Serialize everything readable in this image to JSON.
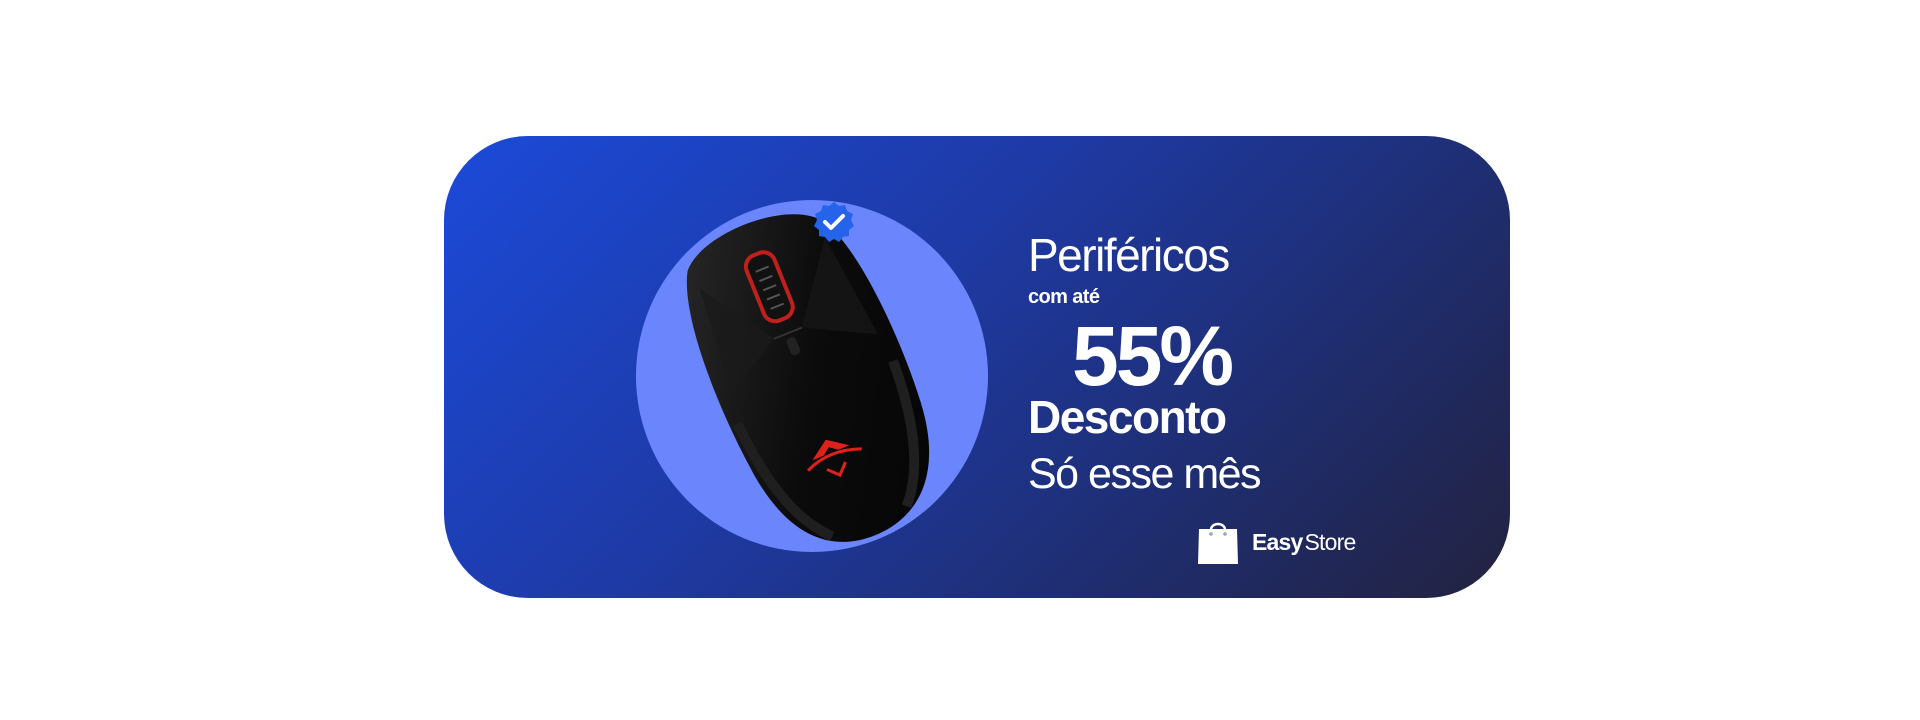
{
  "promo": {
    "headline": "Periféricos",
    "prefix": "com até",
    "discount": "55%",
    "discount_label": "Desconto",
    "tagline": "Só esse mês"
  },
  "brand": {
    "name_bold": "Easy",
    "name_light": "Store",
    "icon": "shopping-bag-icon"
  },
  "product": {
    "icon": "gaming-mouse-image",
    "badge": "verified-check-icon"
  },
  "colors": {
    "banner_start": "#1b4ad9",
    "banner_end": "#23223f",
    "circle": "#6b86fd",
    "badge": "#2563eb",
    "accent_red": "#e0201b",
    "text": "#ffffff"
  }
}
